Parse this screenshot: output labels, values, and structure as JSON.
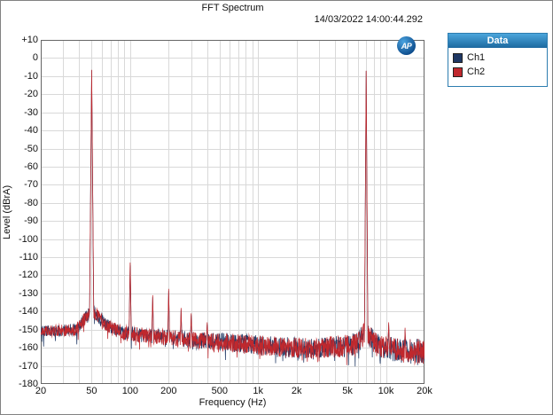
{
  "header": {
    "title": "FFT Spectrum",
    "timestamp": "14/03/2022 14:00:44.292"
  },
  "logo": {
    "text": "AP"
  },
  "legend": {
    "header": "Data",
    "items": [
      {
        "label": "Ch1",
        "color": "#1f3864"
      },
      {
        "label": "Ch2",
        "color": "#c0282d"
      }
    ]
  },
  "chart_data": {
    "type": "line",
    "title": "FFT Spectrum",
    "xlabel": "Frequency (Hz)",
    "ylabel": "Level (dBrA)",
    "x_scale": "log",
    "xlim": [
      20,
      20000
    ],
    "ylim": [
      -180,
      10
    ],
    "grid": true,
    "legend_position": "top-right-outside",
    "grid_color": "#d9d9d9",
    "frame_color": "#666666",
    "x_ticks": [
      {
        "f": 20,
        "label": "20"
      },
      {
        "f": 50,
        "label": "50"
      },
      {
        "f": 100,
        "label": "100"
      },
      {
        "f": 200,
        "label": "200"
      },
      {
        "f": 500,
        "label": "500"
      },
      {
        "f": 1000,
        "label": "1k"
      },
      {
        "f": 2000,
        "label": "2k"
      },
      {
        "f": 5000,
        "label": "5k"
      },
      {
        "f": 10000,
        "label": "10k"
      },
      {
        "f": 20000,
        "label": "20k"
      }
    ],
    "y_ticks": [
      {
        "db": 10,
        "label": "+10"
      },
      {
        "db": 0,
        "label": "0"
      },
      {
        "db": -10,
        "label": "-10"
      },
      {
        "db": -20,
        "label": "-20"
      },
      {
        "db": -30,
        "label": "-30"
      },
      {
        "db": -40,
        "label": "-40"
      },
      {
        "db": -50,
        "label": "-50"
      },
      {
        "db": -60,
        "label": "-60"
      },
      {
        "db": -70,
        "label": "-70"
      },
      {
        "db": -80,
        "label": "-80"
      },
      {
        "db": -90,
        "label": "-90"
      },
      {
        "db": -100,
        "label": "-100"
      },
      {
        "db": -110,
        "label": "-110"
      },
      {
        "db": -120,
        "label": "-120"
      },
      {
        "db": -130,
        "label": "-130"
      },
      {
        "db": -140,
        "label": "-140"
      },
      {
        "db": -150,
        "label": "-150"
      },
      {
        "db": -160,
        "label": "-160"
      },
      {
        "db": -170,
        "label": "-170"
      },
      {
        "db": -180,
        "label": "-180"
      }
    ],
    "noise_jitter_db": [
      3,
      7
    ],
    "series": [
      {
        "name": "Ch1",
        "color": "#1f3864",
        "noise_floor_db": [
          [
            20,
            -151
          ],
          [
            38,
            -150
          ],
          [
            45,
            -143
          ],
          [
            50,
            -139
          ],
          [
            57,
            -143
          ],
          [
            70,
            -149
          ],
          [
            90,
            -152
          ],
          [
            150,
            -153.5
          ],
          [
            300,
            -155.5
          ],
          [
            700,
            -157.5
          ],
          [
            1500,
            -159.5
          ],
          [
            3000,
            -160.5
          ],
          [
            6000,
            -158
          ],
          [
            7000,
            -150
          ],
          [
            8200,
            -158
          ],
          [
            12000,
            -161.5
          ],
          [
            20000,
            -162
          ]
        ],
        "peaks": [
          {
            "f": 50,
            "db": -6.8,
            "hw": 0.016
          },
          {
            "f": 100,
            "db": -114.5,
            "hw": 0.009
          },
          {
            "f": 150,
            "db": -132,
            "hw": 0.007
          },
          {
            "f": 200,
            "db": -128.5,
            "hw": 0.007
          },
          {
            "f": 250,
            "db": -139,
            "hw": 0.006
          },
          {
            "f": 300,
            "db": -142,
            "hw": 0.006
          },
          {
            "f": 400,
            "db": -147,
            "hw": 0.006
          },
          {
            "f": 7000,
            "db": -7.2,
            "hw": 0.013
          },
          {
            "f": 10500,
            "db": -147,
            "hw": 0.006
          },
          {
            "f": 14100,
            "db": -150,
            "hw": 0.005
          }
        ]
      },
      {
        "name": "Ch2",
        "color": "#c0282d",
        "noise_floor_db": [
          [
            20,
            -151
          ],
          [
            38,
            -150
          ],
          [
            45,
            -143
          ],
          [
            50,
            -139
          ],
          [
            57,
            -143
          ],
          [
            70,
            -149
          ],
          [
            90,
            -152
          ],
          [
            150,
            -153.5
          ],
          [
            300,
            -155.5
          ],
          [
            700,
            -157.5
          ],
          [
            1500,
            -159.5
          ],
          [
            3000,
            -160.5
          ],
          [
            6000,
            -158
          ],
          [
            7000,
            -150
          ],
          [
            8200,
            -158
          ],
          [
            12000,
            -161.5
          ],
          [
            20000,
            -162
          ]
        ],
        "peaks": [
          {
            "f": 50,
            "db": -6.5,
            "hw": 0.016
          },
          {
            "f": 100,
            "db": -113,
            "hw": 0.009
          },
          {
            "f": 150,
            "db": -131,
            "hw": 0.007
          },
          {
            "f": 200,
            "db": -127.5,
            "hw": 0.007
          },
          {
            "f": 250,
            "db": -138,
            "hw": 0.006
          },
          {
            "f": 300,
            "db": -141,
            "hw": 0.006
          },
          {
            "f": 400,
            "db": -146,
            "hw": 0.006
          },
          {
            "f": 7000,
            "db": -7,
            "hw": 0.013
          },
          {
            "f": 10500,
            "db": -146,
            "hw": 0.006
          },
          {
            "f": 14100,
            "db": -149,
            "hw": 0.005
          }
        ]
      }
    ]
  }
}
